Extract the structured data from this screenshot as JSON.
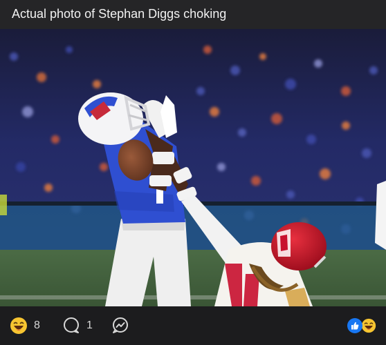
{
  "post": {
    "title": "Actual photo of Stephan Diggs choking"
  },
  "photo": {
    "description_icon": "football-photo",
    "colors": {
      "crowd": "#1f2350",
      "field": "#3d5a3a",
      "bills_jersey": "#2f4fd1",
      "chiefs_helmet": "#c8102e"
    }
  },
  "footer": {
    "reaction_icon": "haha-emoji-icon",
    "reaction_count": "8",
    "comment_icon": "comment-icon",
    "comment_count": "1",
    "share_icon": "share-icon",
    "summary_icons": [
      "like-icon",
      "haha-emoji-icon"
    ]
  }
}
